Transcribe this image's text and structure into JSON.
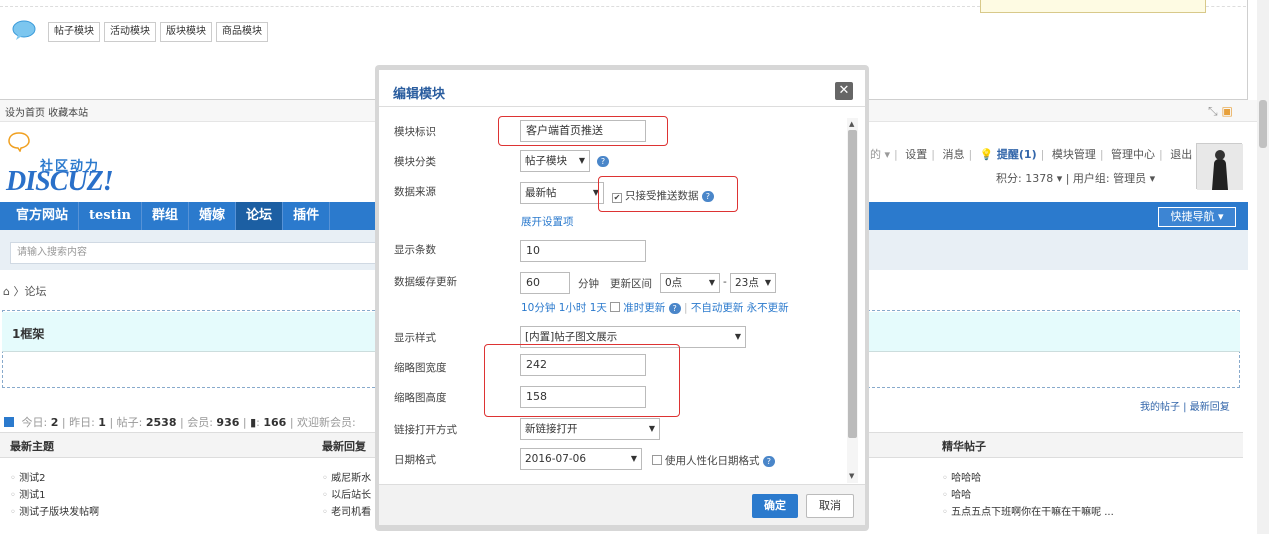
{
  "diy": {
    "tabs": [
      "帖子模块",
      "活动模块",
      "版块模块",
      "商品模块"
    ]
  },
  "topbar": {
    "left": "设为首页  收藏本站"
  },
  "logo": {
    "sub": "社区动力",
    "main": "DISCUZ!"
  },
  "user": {
    "links": [
      "设置",
      "消息",
      "提醒(1)",
      "模块管理",
      "管理中心",
      "退出"
    ],
    "points": "积分: 1378 ▾ |  用户组: 管理员 ▾"
  },
  "nav": {
    "items": [
      "官方网站",
      "testin",
      "群组",
      "婚嫁",
      "论坛",
      "插件"
    ],
    "quick": "快捷导航 ▾"
  },
  "search": {
    "placeholder": "请输入搜索内容"
  },
  "breadcrumb": "⌂ 〉论坛",
  "frame": {
    "title": "1框架"
  },
  "stats": {
    "today_label": "今日:",
    "today": "2",
    "yesterday_label": "昨日:",
    "yesterday": "1",
    "posts_label": "帖子:",
    "posts": "2538",
    "members_label": "会员:",
    "members": "936",
    "online": "166",
    "welcome": "欢迎新会员:"
  },
  "mylinks": "我的帖子 | 最新回复",
  "columns": {
    "newest": {
      "title": "最新主题",
      "items": [
        "测试2",
        "测试1",
        "测试子版块发帖啊"
      ]
    },
    "replies": {
      "title": "最新回复",
      "items": [
        "威尼斯水",
        "以后站长",
        "老司机看"
      ]
    },
    "digest": {
      "title": "精华帖子",
      "items": [
        "哈哈哈",
        "哈哈",
        "五点五点下班啊你在干嘛在干嘛呢 ..."
      ]
    }
  },
  "modal": {
    "title": "编辑模块",
    "close": "✕",
    "fields": {
      "id_label": "模块标识",
      "id_value": "客户端首页推送",
      "cat_label": "模块分类",
      "cat_value": "帖子模块",
      "src_label": "数据来源",
      "src_value": "最新帖",
      "push_label": "只接受推送数据",
      "expand": "展开设置项",
      "count_label": "显示条数",
      "count_value": "10",
      "cache_label": "数据缓存更新",
      "cache_value": "60",
      "cache_unit": "分钟",
      "range_label": "更新区间",
      "range_from": "0点",
      "range_to": "23点",
      "quick_times": "10分钟  1小时  1天",
      "on_time": "准时更新",
      "no_auto": "不自动更新  永不更新",
      "style_label": "显示样式",
      "style_value": "[内置]帖子图文展示",
      "w_label": "缩略图宽度",
      "w_value": "242",
      "h_label": "缩略图高度",
      "h_value": "158",
      "link_label": "链接打开方式",
      "link_value": "新链接打开",
      "date_label": "日期格式",
      "date_value": "2016-07-06",
      "human_date": "使用人性化日期格式"
    },
    "ok": "确定",
    "cancel": "取消"
  }
}
